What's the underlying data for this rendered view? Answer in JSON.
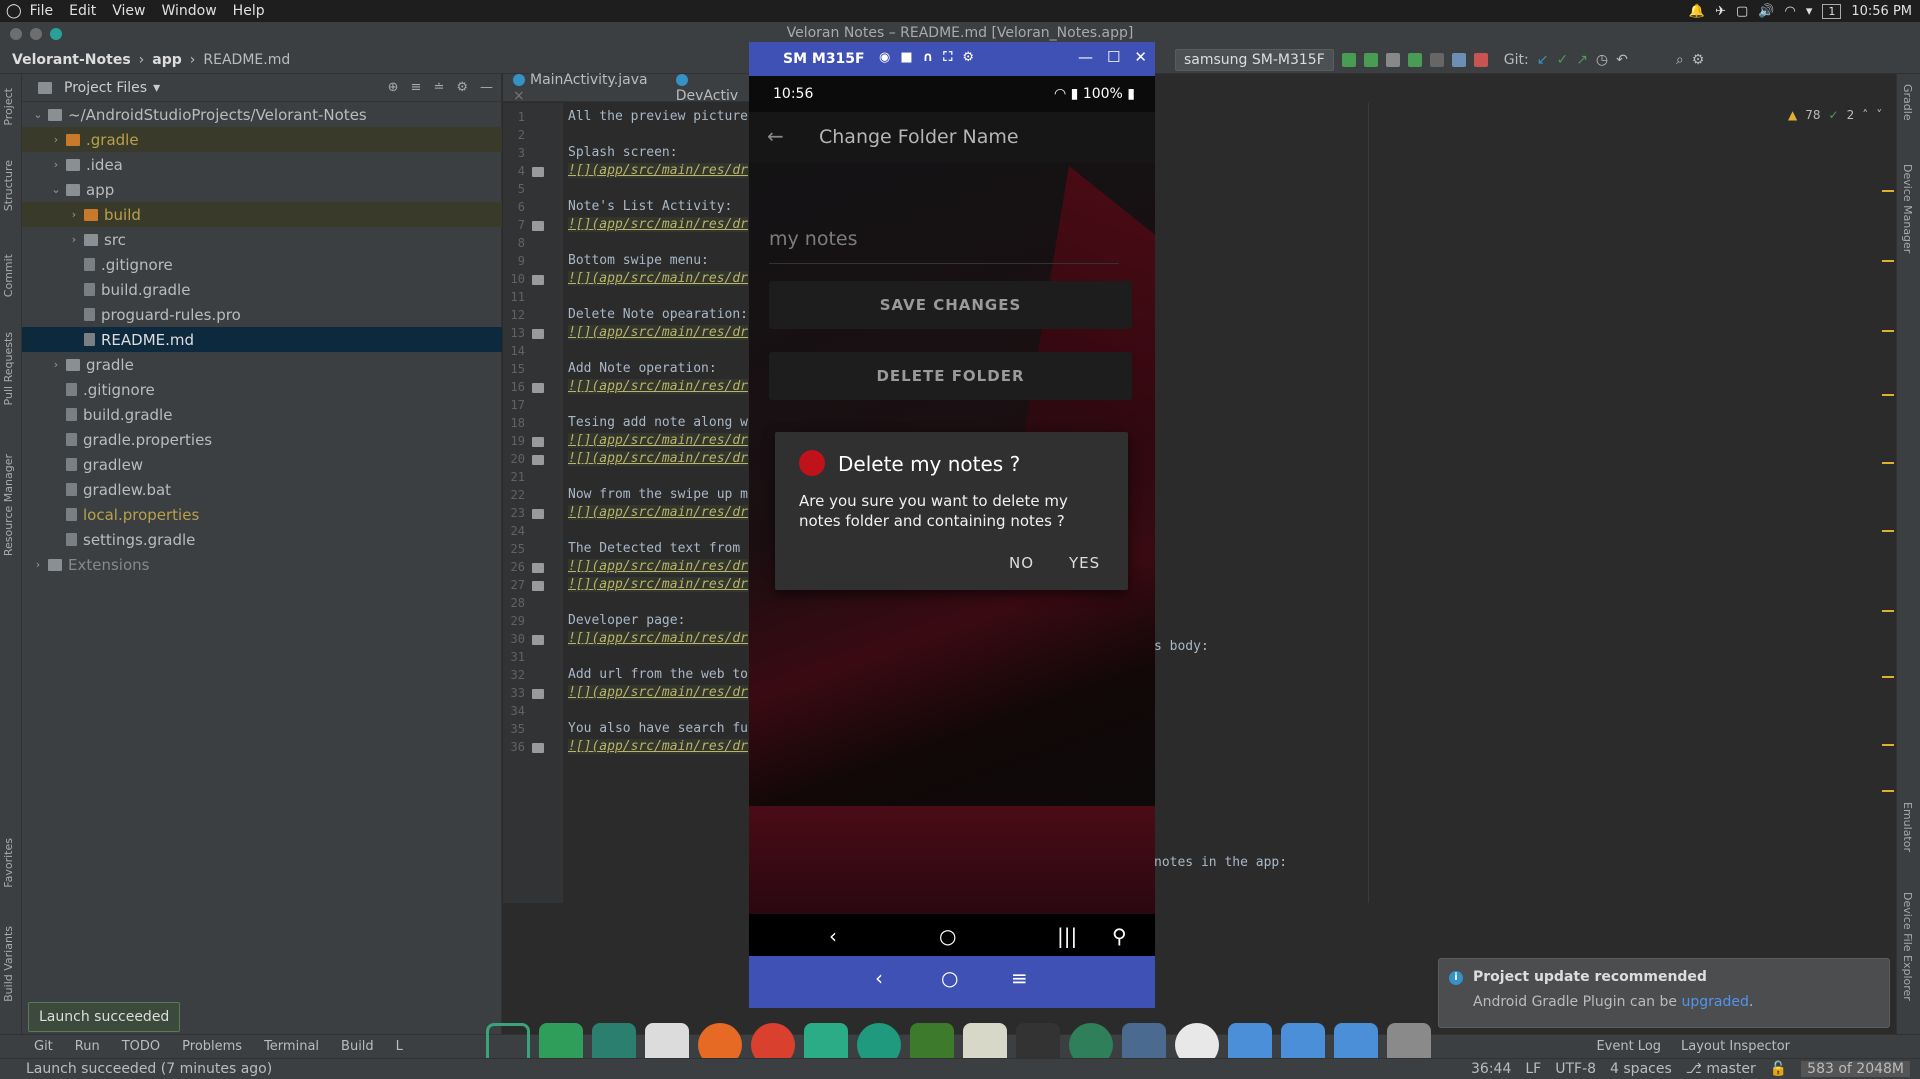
{
  "sysbar": {
    "menus": [
      "File",
      "Edit",
      "View",
      "Window",
      "Help"
    ],
    "workspace": "1",
    "clock": "10:56 PM"
  },
  "window": {
    "title": "Veloran Notes – README.md [Veloran_Notes.app]"
  },
  "breadcrumb": {
    "root": "Velorant-Notes",
    "module": "app",
    "file": "README.md"
  },
  "toolbar": {
    "device": "samsung SM-M315F",
    "git_label": "Git:"
  },
  "project": {
    "header": "Project Files",
    "items": [
      {
        "label": "~/AndroidStudioProjects/Velorant-Notes",
        "depth": 0,
        "open": true,
        "kind": "folder"
      },
      {
        "label": ".gradle",
        "depth": 1,
        "open": false,
        "kind": "folder-orange",
        "style": "ignored"
      },
      {
        "label": ".idea",
        "depth": 1,
        "open": false,
        "kind": "folder"
      },
      {
        "label": "app",
        "depth": 1,
        "open": true,
        "kind": "folder"
      },
      {
        "label": "build",
        "depth": 2,
        "open": false,
        "kind": "folder-orange",
        "style": "ignored"
      },
      {
        "label": "src",
        "depth": 2,
        "open": false,
        "kind": "folder"
      },
      {
        "label": ".gitignore",
        "depth": 2,
        "kind": "file"
      },
      {
        "label": "build.gradle",
        "depth": 2,
        "kind": "file"
      },
      {
        "label": "proguard-rules.pro",
        "depth": 2,
        "kind": "file"
      },
      {
        "label": "README.md",
        "depth": 2,
        "kind": "file",
        "style": "selected"
      },
      {
        "label": "gradle",
        "depth": 1,
        "open": false,
        "kind": "folder"
      },
      {
        "label": ".gitignore",
        "depth": 1,
        "kind": "file"
      },
      {
        "label": "build.gradle",
        "depth": 1,
        "kind": "file"
      },
      {
        "label": "gradle.properties",
        "depth": 1,
        "kind": "file"
      },
      {
        "label": "gradlew",
        "depth": 1,
        "kind": "file"
      },
      {
        "label": "gradlew.bat",
        "depth": 1,
        "kind": "file"
      },
      {
        "label": "local.properties",
        "depth": 1,
        "kind": "file",
        "style": "yellow"
      },
      {
        "label": "settings.gradle",
        "depth": 1,
        "kind": "file"
      },
      {
        "label": "Extensions",
        "depth": 0,
        "open": false,
        "kind": "folder",
        "style": "dim"
      }
    ]
  },
  "tool_windows_left": [
    "Project",
    "Structure",
    "Commit",
    "Pull Requests",
    "Resource Manager",
    "Favorites",
    "Build Variants"
  ],
  "tool_windows_right": [
    "Gradle",
    "Device Manager",
    "Emulator",
    "Device File Explorer"
  ],
  "editor": {
    "tabs": [
      "MainActivity.java",
      "DevActiv"
    ],
    "inspections": {
      "warnings": "78",
      "weak_warnings": "2"
    },
    "lines": [
      {
        "n": "1",
        "text": "All the preview picture"
      },
      {
        "n": "2",
        "text": ""
      },
      {
        "n": "3",
        "text": "Splash screen:"
      },
      {
        "n": "4",
        "text": "![](app/src/main/res/dr",
        "img": true
      },
      {
        "n": "5",
        "text": ""
      },
      {
        "n": "6",
        "text": "Note's List Activity:"
      },
      {
        "n": "7",
        "text": "![](app/src/main/res/dr",
        "img": true
      },
      {
        "n": "8",
        "text": ""
      },
      {
        "n": "9",
        "text": "Bottom swipe menu:"
      },
      {
        "n": "10",
        "text": "![](app/src/main/res/dr",
        "img": true
      },
      {
        "n": "11",
        "text": ""
      },
      {
        "n": "12",
        "text": "Delete Note opearation:"
      },
      {
        "n": "13",
        "text": "![](app/src/main/res/dr",
        "img": true
      },
      {
        "n": "14",
        "text": ""
      },
      {
        "n": "15",
        "text": "Add Note operation:"
      },
      {
        "n": "16",
        "text": "![](app/src/main/res/dr",
        "img": true
      },
      {
        "n": "17",
        "text": ""
      },
      {
        "n": "18",
        "text": "Tesing add note along w"
      },
      {
        "n": "19",
        "text": "![](app/src/main/res/dr",
        "img": true
      },
      {
        "n": "20",
        "text": "![](app/src/main/res/dr",
        "img": true
      },
      {
        "n": "21",
        "text": ""
      },
      {
        "n": "22",
        "text": "Now from the swipe up m"
      },
      {
        "n": "23",
        "text": "![](app/src/main/res/dr",
        "img": true
      },
      {
        "n": "24",
        "text": ""
      },
      {
        "n": "25",
        "text": "The Detected text from"
      },
      {
        "n": "26",
        "text": "![](app/src/main/res/dr",
        "img": true
      },
      {
        "n": "27",
        "text": "![](app/src/main/res/dr",
        "img": true
      },
      {
        "n": "28",
        "text": ""
      },
      {
        "n": "29",
        "text": "Developer page:"
      },
      {
        "n": "30",
        "text": "![](app/src/main/res/dr",
        "img": true
      },
      {
        "n": "31",
        "text": ""
      },
      {
        "n": "32",
        "text": "Add url from the web to"
      },
      {
        "n": "33",
        "text": "![](app/src/main/res/dr",
        "img": true
      },
      {
        "n": "34",
        "text": ""
      },
      {
        "n": "35",
        "text": "You also have search fu"
      },
      {
        "n": "36",
        "text": "![](app/src/main/res/dr",
        "img": true
      }
    ],
    "overflow_25": "s body:",
    "overflow_35": "notes in the app:"
  },
  "emulator": {
    "device_name": "SM M315F",
    "phone": {
      "time": "10:56",
      "battery": "100%",
      "screen_title": "Change Folder Name",
      "folder_name_value": "my notes",
      "save_button": "SAVE CHANGES",
      "delete_button": "DELETE FOLDER"
    },
    "dialog": {
      "title": "Delete my notes ?",
      "message": "Are you sure you want to delete my notes folder and containing notes ?",
      "negative": "NO",
      "positive": "YES"
    }
  },
  "bottom_tools": [
    "Git",
    "Run",
    "TODO",
    "Problems",
    "Terminal",
    "Build",
    "L"
  ],
  "bottom_tools_right": [
    "Event Log",
    "Layout Inspector"
  ],
  "toast": "Launch succeeded",
  "status": {
    "message": "Launch succeeded (7 minutes ago)",
    "position": "36:44",
    "line_sep": "LF",
    "encoding": "UTF-8",
    "indent": "4 spaces",
    "branch": "master",
    "memory": "583 of 2048M"
  },
  "notification": {
    "title": "Project update recommended",
    "body_prefix": "Android Gradle Plugin can be ",
    "link": "upgraded",
    "body_suffix": "."
  },
  "colors": {
    "accent": "#3f51b5",
    "danger": "#c0121a",
    "selection": "#0d293e"
  }
}
